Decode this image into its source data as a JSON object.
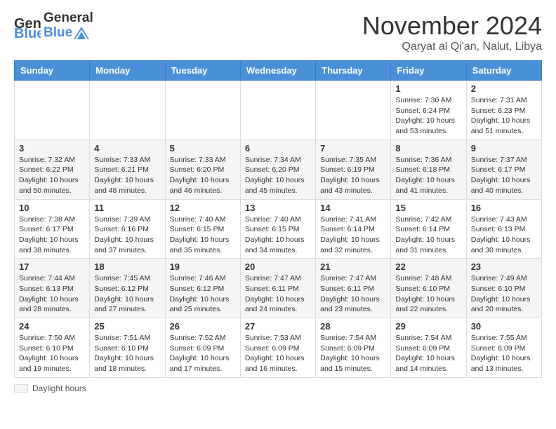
{
  "logo": {
    "general": "General",
    "blue": "Blue"
  },
  "title": "November 2024",
  "subtitle": "Qaryat al Qi'an, Nalut, Libya",
  "days_of_week": [
    "Sunday",
    "Monday",
    "Tuesday",
    "Wednesday",
    "Thursday",
    "Friday",
    "Saturday"
  ],
  "legend": "Daylight hours",
  "weeks": [
    [
      {
        "day": "",
        "info": ""
      },
      {
        "day": "",
        "info": ""
      },
      {
        "day": "",
        "info": ""
      },
      {
        "day": "",
        "info": ""
      },
      {
        "day": "",
        "info": ""
      },
      {
        "day": "1",
        "info": "Sunrise: 7:30 AM\nSunset: 6:24 PM\nDaylight: 10 hours\nand 53 minutes."
      },
      {
        "day": "2",
        "info": "Sunrise: 7:31 AM\nSunset: 6:23 PM\nDaylight: 10 hours\nand 51 minutes."
      }
    ],
    [
      {
        "day": "3",
        "info": "Sunrise: 7:32 AM\nSunset: 6:22 PM\nDaylight: 10 hours\nand 50 minutes."
      },
      {
        "day": "4",
        "info": "Sunrise: 7:33 AM\nSunset: 6:21 PM\nDaylight: 10 hours\nand 48 minutes."
      },
      {
        "day": "5",
        "info": "Sunrise: 7:33 AM\nSunset: 6:20 PM\nDaylight: 10 hours\nand 46 minutes."
      },
      {
        "day": "6",
        "info": "Sunrise: 7:34 AM\nSunset: 6:20 PM\nDaylight: 10 hours\nand 45 minutes."
      },
      {
        "day": "7",
        "info": "Sunrise: 7:35 AM\nSunset: 6:19 PM\nDaylight: 10 hours\nand 43 minutes."
      },
      {
        "day": "8",
        "info": "Sunrise: 7:36 AM\nSunset: 6:18 PM\nDaylight: 10 hours\nand 41 minutes."
      },
      {
        "day": "9",
        "info": "Sunrise: 7:37 AM\nSunset: 6:17 PM\nDaylight: 10 hours\nand 40 minutes."
      }
    ],
    [
      {
        "day": "10",
        "info": "Sunrise: 7:38 AM\nSunset: 6:17 PM\nDaylight: 10 hours\nand 38 minutes."
      },
      {
        "day": "11",
        "info": "Sunrise: 7:39 AM\nSunset: 6:16 PM\nDaylight: 10 hours\nand 37 minutes."
      },
      {
        "day": "12",
        "info": "Sunrise: 7:40 AM\nSunset: 6:15 PM\nDaylight: 10 hours\nand 35 minutes."
      },
      {
        "day": "13",
        "info": "Sunrise: 7:40 AM\nSunset: 6:15 PM\nDaylight: 10 hours\nand 34 minutes."
      },
      {
        "day": "14",
        "info": "Sunrise: 7:41 AM\nSunset: 6:14 PM\nDaylight: 10 hours\nand 32 minutes."
      },
      {
        "day": "15",
        "info": "Sunrise: 7:42 AM\nSunset: 6:14 PM\nDaylight: 10 hours\nand 31 minutes."
      },
      {
        "day": "16",
        "info": "Sunrise: 7:43 AM\nSunset: 6:13 PM\nDaylight: 10 hours\nand 30 minutes."
      }
    ],
    [
      {
        "day": "17",
        "info": "Sunrise: 7:44 AM\nSunset: 6:13 PM\nDaylight: 10 hours\nand 28 minutes."
      },
      {
        "day": "18",
        "info": "Sunrise: 7:45 AM\nSunset: 6:12 PM\nDaylight: 10 hours\nand 27 minutes."
      },
      {
        "day": "19",
        "info": "Sunrise: 7:46 AM\nSunset: 6:12 PM\nDaylight: 10 hours\nand 25 minutes."
      },
      {
        "day": "20",
        "info": "Sunrise: 7:47 AM\nSunset: 6:11 PM\nDaylight: 10 hours\nand 24 minutes."
      },
      {
        "day": "21",
        "info": "Sunrise: 7:47 AM\nSunset: 6:11 PM\nDaylight: 10 hours\nand 23 minutes."
      },
      {
        "day": "22",
        "info": "Sunrise: 7:48 AM\nSunset: 6:10 PM\nDaylight: 10 hours\nand 22 minutes."
      },
      {
        "day": "23",
        "info": "Sunrise: 7:49 AM\nSunset: 6:10 PM\nDaylight: 10 hours\nand 20 minutes."
      }
    ],
    [
      {
        "day": "24",
        "info": "Sunrise: 7:50 AM\nSunset: 6:10 PM\nDaylight: 10 hours\nand 19 minutes."
      },
      {
        "day": "25",
        "info": "Sunrise: 7:51 AM\nSunset: 6:10 PM\nDaylight: 10 hours\nand 18 minutes."
      },
      {
        "day": "26",
        "info": "Sunrise: 7:52 AM\nSunset: 6:09 PM\nDaylight: 10 hours\nand 17 minutes."
      },
      {
        "day": "27",
        "info": "Sunrise: 7:53 AM\nSunset: 6:09 PM\nDaylight: 10 hours\nand 16 minutes."
      },
      {
        "day": "28",
        "info": "Sunrise: 7:54 AM\nSunset: 6:09 PM\nDaylight: 10 hours\nand 15 minutes."
      },
      {
        "day": "29",
        "info": "Sunrise: 7:54 AM\nSunset: 6:09 PM\nDaylight: 10 hours\nand 14 minutes."
      },
      {
        "day": "30",
        "info": "Sunrise: 7:55 AM\nSunset: 6:09 PM\nDaylight: 10 hours\nand 13 minutes."
      }
    ]
  ]
}
